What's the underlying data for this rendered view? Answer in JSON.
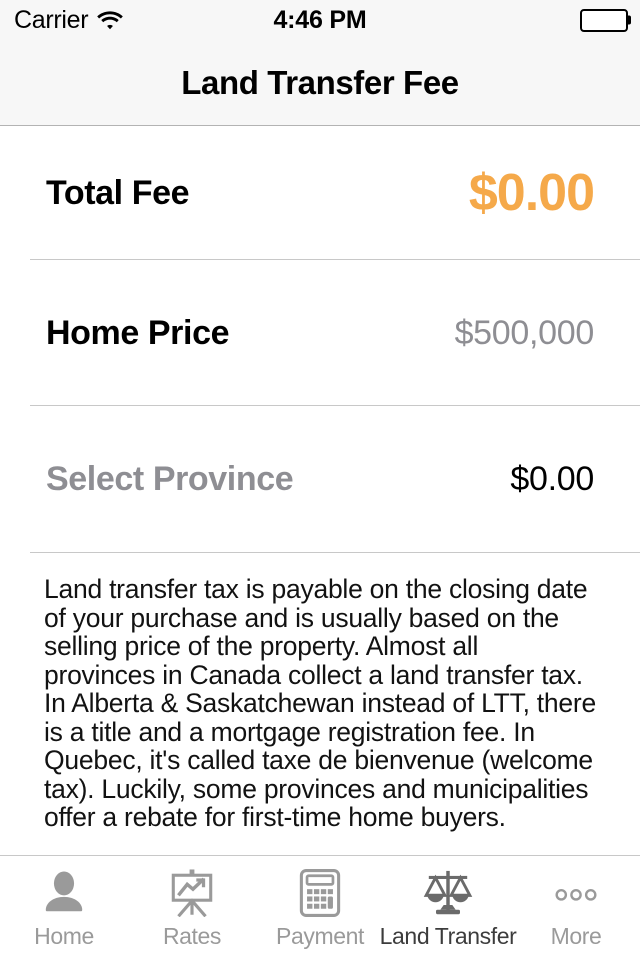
{
  "status_bar": {
    "carrier": "Carrier",
    "wifi_icon": "wifi-icon",
    "time": "4:46 PM",
    "battery_icon": "battery-full-icon"
  },
  "nav_bar": {
    "title": "Land Transfer Fee"
  },
  "colors": {
    "accent_orange": "#f5a94a",
    "muted_gray": "#8e8e93",
    "separator": "#c8c8c8",
    "tab_inactive": "#9a9a9a",
    "tab_active": "#3c3c3c",
    "bar_background": "#f7f7f7"
  },
  "rows": [
    {
      "label": "Total Fee",
      "value": "$0.00",
      "label_style": "bold-dark",
      "value_style": "accent-large"
    },
    {
      "label": "Home Price",
      "value": "$500,000",
      "label_style": "bold-dark",
      "value_style": "muted"
    },
    {
      "label": "Select Province",
      "value": "$0.00",
      "label_style": "bold-muted",
      "value_style": "dark"
    }
  ],
  "description": {
    "text": "Land transfer tax is payable on the closing date of your purchase and is usually based on the selling price of the property. Almost all provinces in Canada collect a land transfer tax. In Alberta & Saskatchewan instead of LTT, there is a title and a mortgage registration fee. In Quebec, it's called taxe de bienvenue (welcome tax). Luckily, some provinces and municipalities offer a rebate for first-time home buyers."
  },
  "tab_bar": {
    "items": [
      {
        "label": "Home",
        "icon": "person-icon",
        "active": false
      },
      {
        "label": "Rates",
        "icon": "chart-easel-icon",
        "active": false
      },
      {
        "label": "Payment",
        "icon": "calculator-icon",
        "active": false
      },
      {
        "label": "Land Transfer",
        "icon": "scales-icon",
        "active": true
      },
      {
        "label": "More",
        "icon": "ellipsis-icon",
        "active": false
      }
    ]
  }
}
